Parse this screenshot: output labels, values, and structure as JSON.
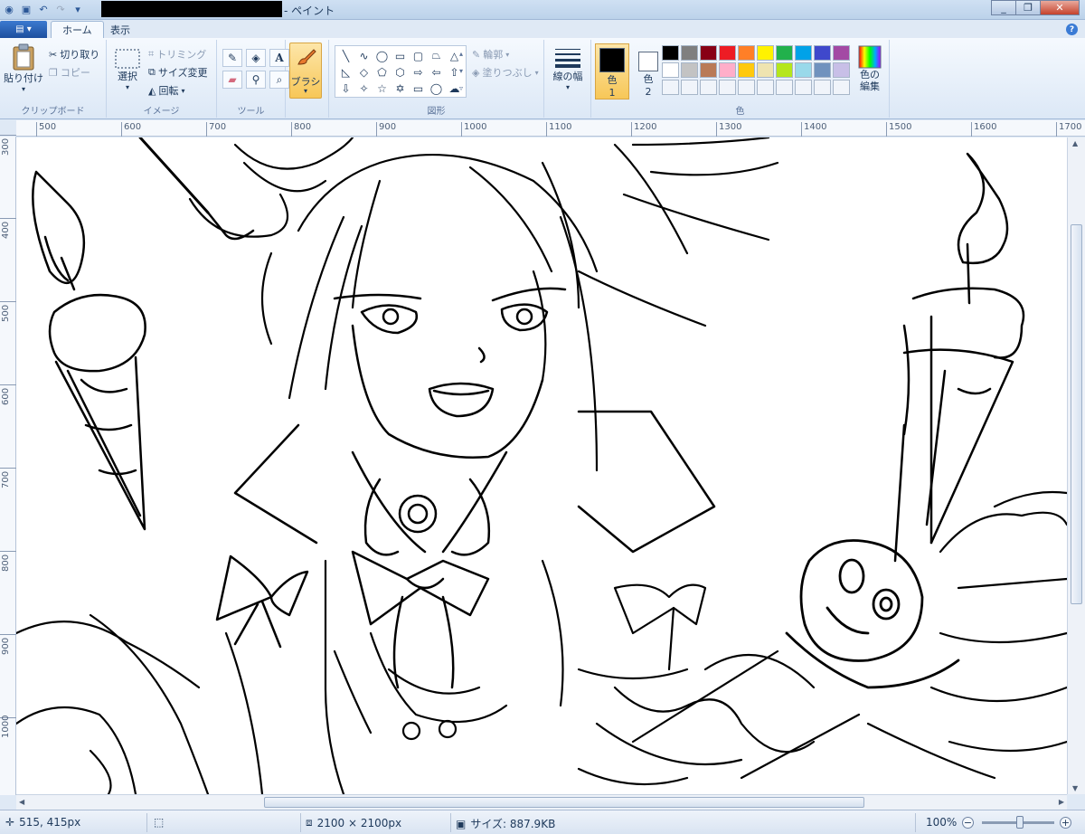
{
  "window": {
    "title_suffix": "- ペイント",
    "help_label": "?"
  },
  "tabs": {
    "app_menu": "▤ ▾",
    "home": "ホーム",
    "view": "表示"
  },
  "clipboard": {
    "paste": "貼り付け",
    "cut": "切り取り",
    "copy": "コピー",
    "label": "クリップボード"
  },
  "image": {
    "select": "選択",
    "crop": "トリミング",
    "resize": "サイズ変更",
    "rotate": "回転",
    "label": "イメージ"
  },
  "tools": {
    "label": "ツール"
  },
  "brush": {
    "label": "ブラシ"
  },
  "shapes": {
    "outline": "輪郭",
    "fill": "塗りつぶし",
    "label": "図形"
  },
  "size": {
    "label": "線の幅"
  },
  "colors": {
    "color1_label": "色",
    "color1_num": "1",
    "color2_label": "色",
    "color2_num": "2",
    "edit_label": "色の編集",
    "label": "色",
    "color1": "#000000",
    "color2": "#ffffff",
    "palette_row1": [
      "#000000",
      "#7f7f7f",
      "#880015",
      "#ed1c24",
      "#ff7f27",
      "#fff200",
      "#22b14c",
      "#00a2e8",
      "#3f48cc",
      "#a349a4"
    ],
    "palette_row2": [
      "#ffffff",
      "#c3c3c3",
      "#b97a57",
      "#ffaec9",
      "#ffc90e",
      "#efe4b0",
      "#b5e61d",
      "#99d9ea",
      "#7092be",
      "#c8bfe7"
    ]
  },
  "ruler_top": [
    "500",
    "600",
    "700",
    "800",
    "900",
    "1000",
    "1100",
    "1200",
    "1300",
    "1400",
    "1500",
    "1600",
    "1700"
  ],
  "ruler_left": [
    "300",
    "400",
    "500",
    "600",
    "700",
    "800",
    "900",
    "1000"
  ],
  "status": {
    "cursor": "515, 415px",
    "image_size": "2100 × 2100px",
    "file_size": "サイズ: 887.9KB",
    "zoom": "100%"
  }
}
